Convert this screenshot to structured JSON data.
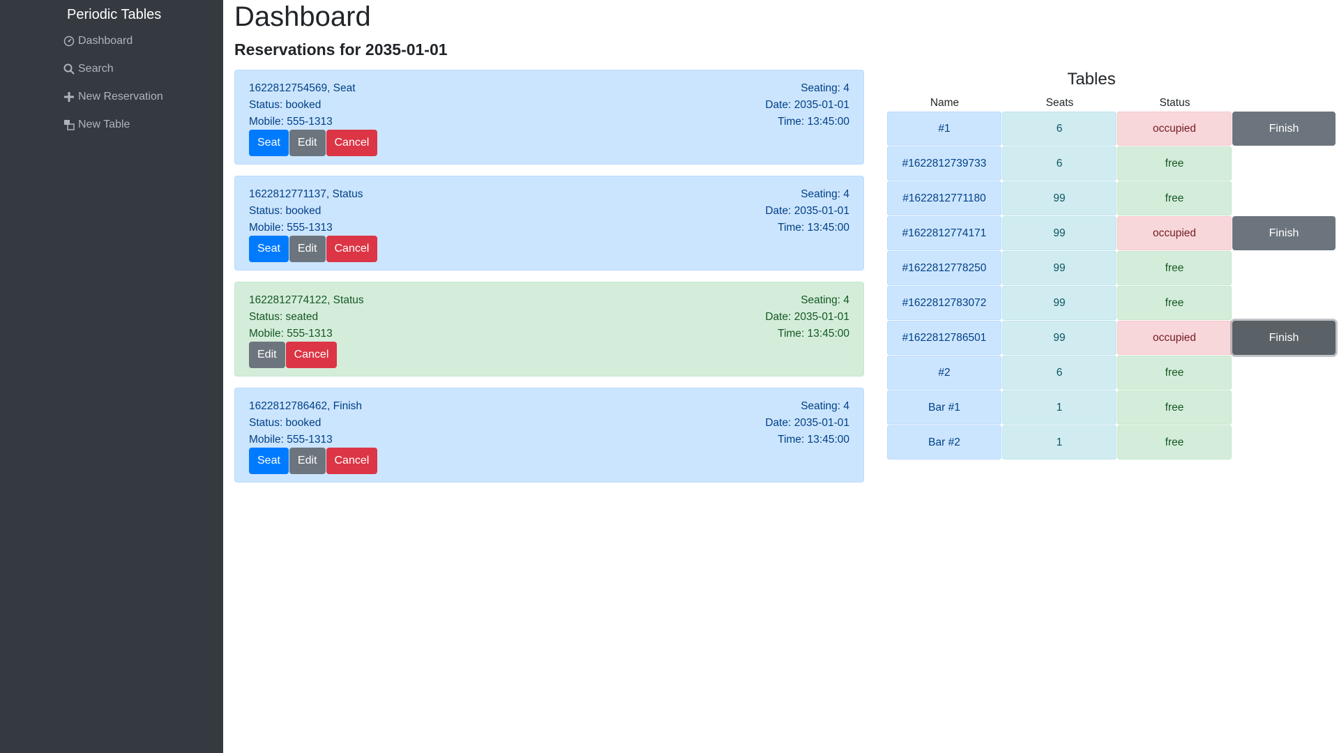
{
  "sidebar": {
    "brand": "Periodic Tables",
    "items": [
      {
        "label": "Dashboard",
        "icon": "dashboard-icon"
      },
      {
        "label": "Search",
        "icon": "search-icon"
      },
      {
        "label": "New Reservation",
        "icon": "plus-icon"
      },
      {
        "label": "New Table",
        "icon": "table-icon"
      }
    ]
  },
  "header": {
    "title": "Dashboard",
    "subtitle": "Reservations for 2035-01-01"
  },
  "reservations": [
    {
      "title": "1622812754569, Seat",
      "status": "Status: booked",
      "mobile": "Mobile: 555-1313",
      "seating": "Seating: 4",
      "date": "Date: 2035-01-01",
      "time": "Time: 13:45:00",
      "seat_label": "Seat",
      "edit_label": "Edit",
      "cancel_label": "Cancel"
    },
    {
      "title": "1622812771137, Status",
      "status": "Status: booked",
      "mobile": "Mobile: 555-1313",
      "seating": "Seating: 4",
      "date": "Date: 2035-01-01",
      "time": "Time: 13:45:00",
      "seat_label": "Seat",
      "edit_label": "Edit",
      "cancel_label": "Cancel"
    },
    {
      "title": "1622812774122, Status",
      "status": "Status: seated",
      "mobile": "Mobile: 555-1313",
      "seating": "Seating: 4",
      "date": "Date: 2035-01-01",
      "time": "Time: 13:45:00",
      "edit_label": "Edit",
      "cancel_label": "Cancel"
    },
    {
      "title": "1622812786462, Finish",
      "status": "Status: booked",
      "mobile": "Mobile: 555-1313",
      "seating": "Seating: 4",
      "date": "Date: 2035-01-01",
      "time": "Time: 13:45:00",
      "seat_label": "Seat",
      "edit_label": "Edit",
      "cancel_label": "Cancel"
    }
  ],
  "tables_panel": {
    "title": "Tables",
    "columns": [
      "Name",
      "Seats",
      "Status"
    ],
    "finish_label": "Finish",
    "rows": [
      {
        "name": "#1",
        "seats": "6",
        "status": "occupied"
      },
      {
        "name": "#1622812739733",
        "seats": "6",
        "status": "free"
      },
      {
        "name": "#1622812771180",
        "seats": "99",
        "status": "free"
      },
      {
        "name": "#1622812774171",
        "seats": "99",
        "status": "occupied"
      },
      {
        "name": "#1622812778250",
        "seats": "99",
        "status": "free"
      },
      {
        "name": "#1622812783072",
        "seats": "99",
        "status": "free"
      },
      {
        "name": "#1622812786501",
        "seats": "99",
        "status": "occupied"
      },
      {
        "name": "#2",
        "seats": "6",
        "status": "free"
      },
      {
        "name": "Bar #1",
        "seats": "1",
        "status": "free"
      },
      {
        "name": "Bar #2",
        "seats": "1",
        "status": "free"
      }
    ]
  },
  "colors": {
    "sidebar_bg": "#343a40",
    "primary": "#007bff",
    "secondary": "#6c757d",
    "danger": "#dc3545"
  }
}
